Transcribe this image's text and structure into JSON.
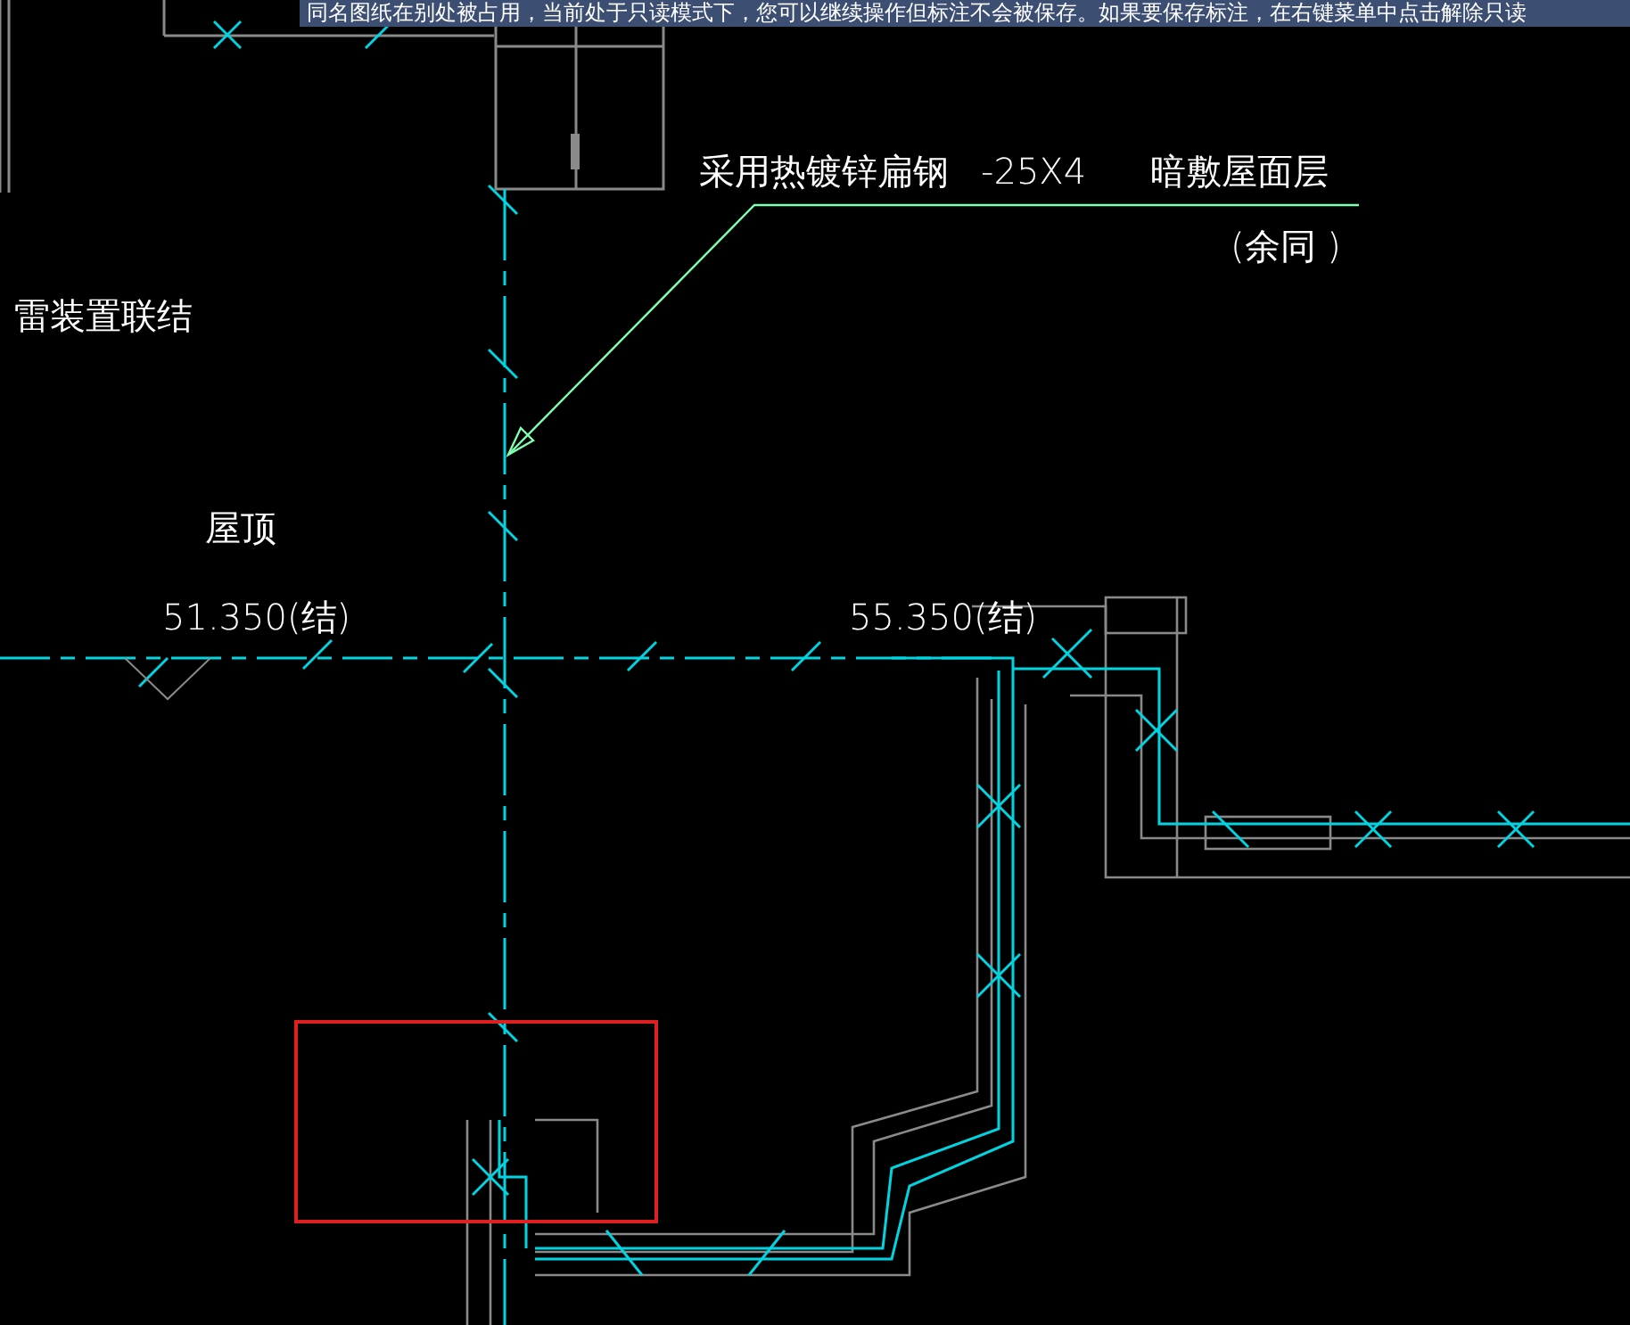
{
  "banner": {
    "message": "同名图纸在别处被占用，当前处于只读模式下，您可以继续操作但标注不会被保存。如果要保存标注，在右键菜单中点击解除只读"
  },
  "annotations": [
    {
      "text": "采用热镀锌扁钢"
    },
    {
      "text": "-25X4"
    },
    {
      "text": "暗敷屋面层"
    },
    {
      "text": "(余同 )"
    },
    {
      "text": "雷装置联结"
    },
    {
      "text": "屋顶"
    },
    {
      "text": "51.350(结)"
    },
    {
      "text": "55.350(结)"
    }
  ]
}
